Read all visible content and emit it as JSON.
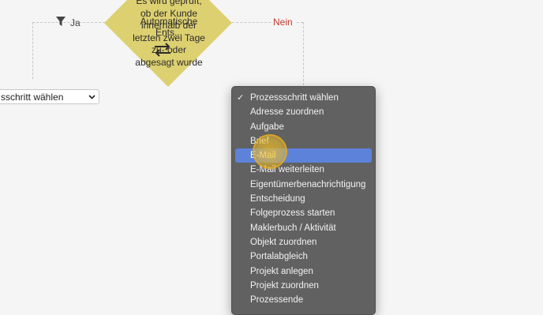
{
  "flow": {
    "decision_text_top": "Es wird geprüft, ob der Kunde innerhalb der letzten zwei Tage zu- oder abgesagt wurde",
    "decision_text_overlay": "Automatische Ents...",
    "branch_yes": "Ja",
    "branch_no": "Nein"
  },
  "step_select": {
    "value": "sschritt wählen"
  },
  "dropdown": {
    "items": [
      {
        "label": "Prozessschritt wählen",
        "checked": true
      },
      {
        "label": "Adresse zuordnen"
      },
      {
        "label": "Aufgabe"
      },
      {
        "label": "Brief"
      },
      {
        "label": "E-Mail",
        "highlighted": true
      },
      {
        "label": "E-Mail weiterleiten"
      },
      {
        "label": "Eigentümerbenachrichtigung"
      },
      {
        "label": "Entscheidung"
      },
      {
        "label": "Folgeprozess starten"
      },
      {
        "label": "Maklerbuch / Aktivität"
      },
      {
        "label": "Objekt zuordnen"
      },
      {
        "label": "Portalabgleich"
      },
      {
        "label": "Projekt anlegen"
      },
      {
        "label": "Projekt zuordnen"
      },
      {
        "label": "Prozessende"
      }
    ],
    "check_glyph": "✓"
  },
  "colors": {
    "diamond": "#ddd071",
    "dropdown_bg": "#616161",
    "highlight": "#5d82d9",
    "no_label": "#c0392b"
  }
}
